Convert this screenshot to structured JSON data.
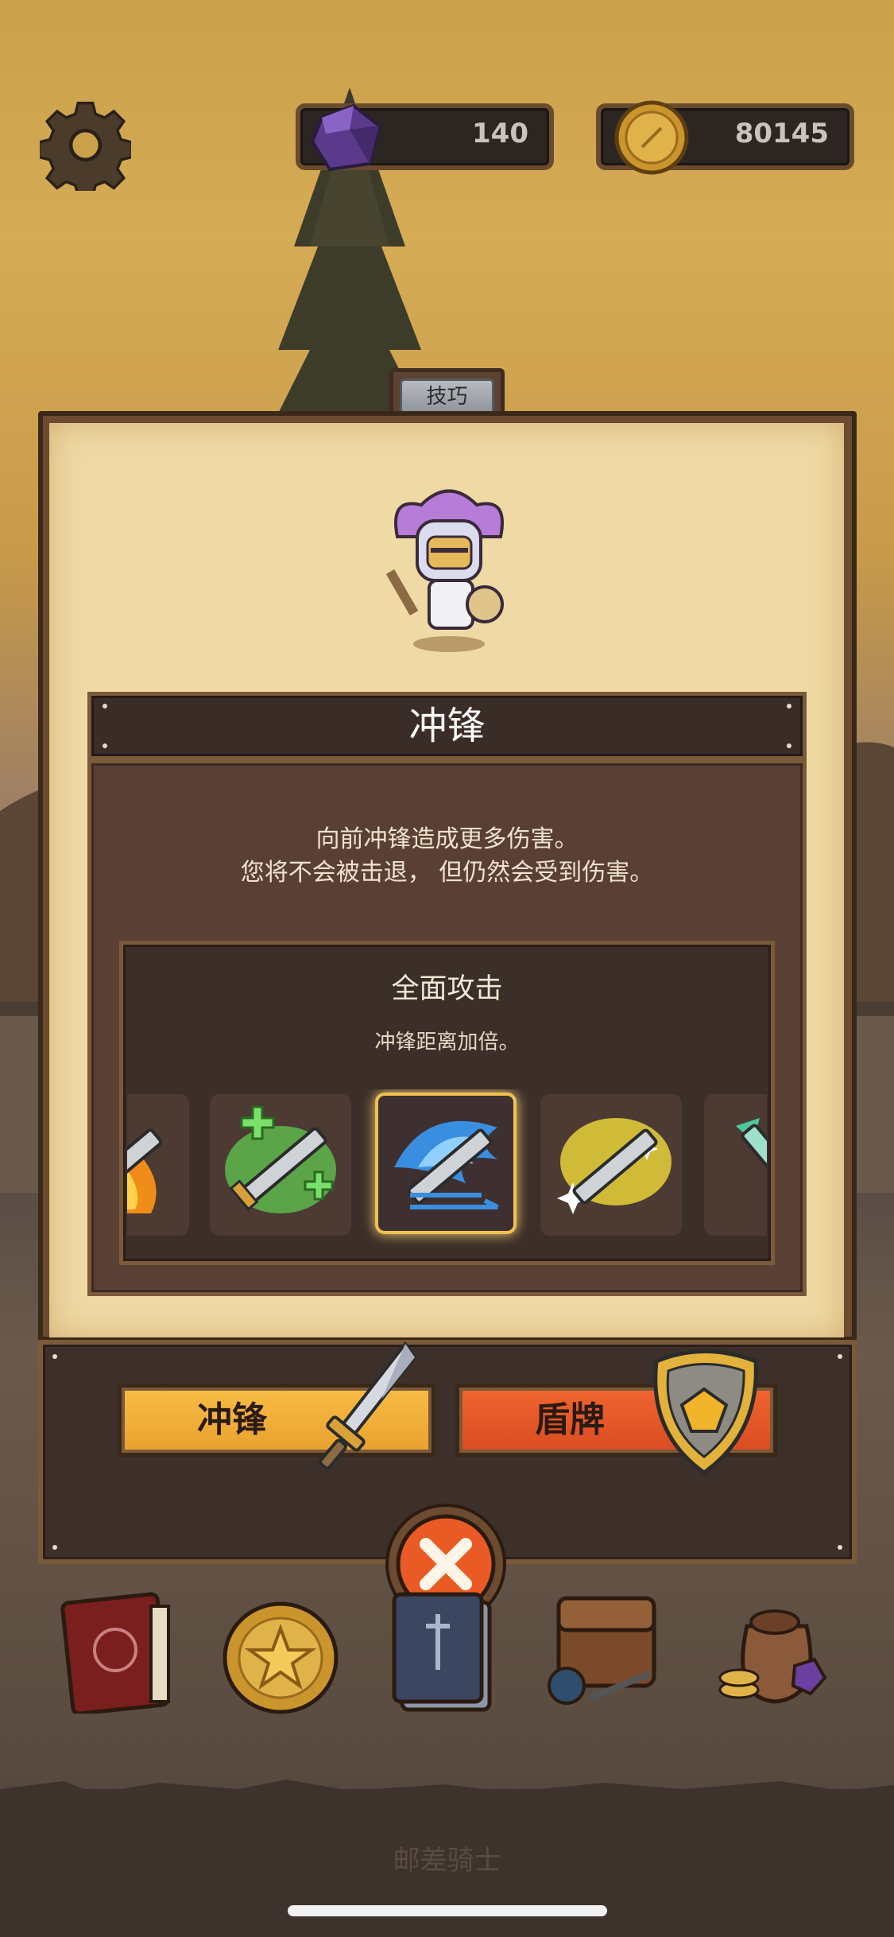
{
  "resources": {
    "gems": "140",
    "coins": "80145"
  },
  "tab": {
    "label": "技巧"
  },
  "skill": {
    "name": "冲锋",
    "description_line1": "向前冲锋造成更多伤害。",
    "description_line2": "您将不会被击退， 但仍然会受到伤害。"
  },
  "upgrade": {
    "title": "全面攻击",
    "description": "冲锋距离加倍。",
    "slots": [
      {
        "icon": "fire-sword-icon",
        "selected": false
      },
      {
        "icon": "heal-sword-icon",
        "selected": false
      },
      {
        "icon": "wind-sword-icon",
        "selected": true
      },
      {
        "icon": "light-sword-icon",
        "selected": false
      },
      {
        "icon": "arrow-sword-icon",
        "selected": false
      }
    ]
  },
  "actions": {
    "charge_label": "冲锋",
    "shield_label": "盾牌"
  },
  "nav": {
    "items": [
      "book-icon",
      "star-coin-icon",
      "cards-icon",
      "backpack-icon",
      "loot-bag-icon"
    ]
  },
  "footer": {
    "title": "邮差骑士"
  },
  "colors": {
    "parchment": "#efd9a4",
    "charge_button": "#f9bd46",
    "shield_button": "#f0642f",
    "selected_border": "#f0c050"
  }
}
